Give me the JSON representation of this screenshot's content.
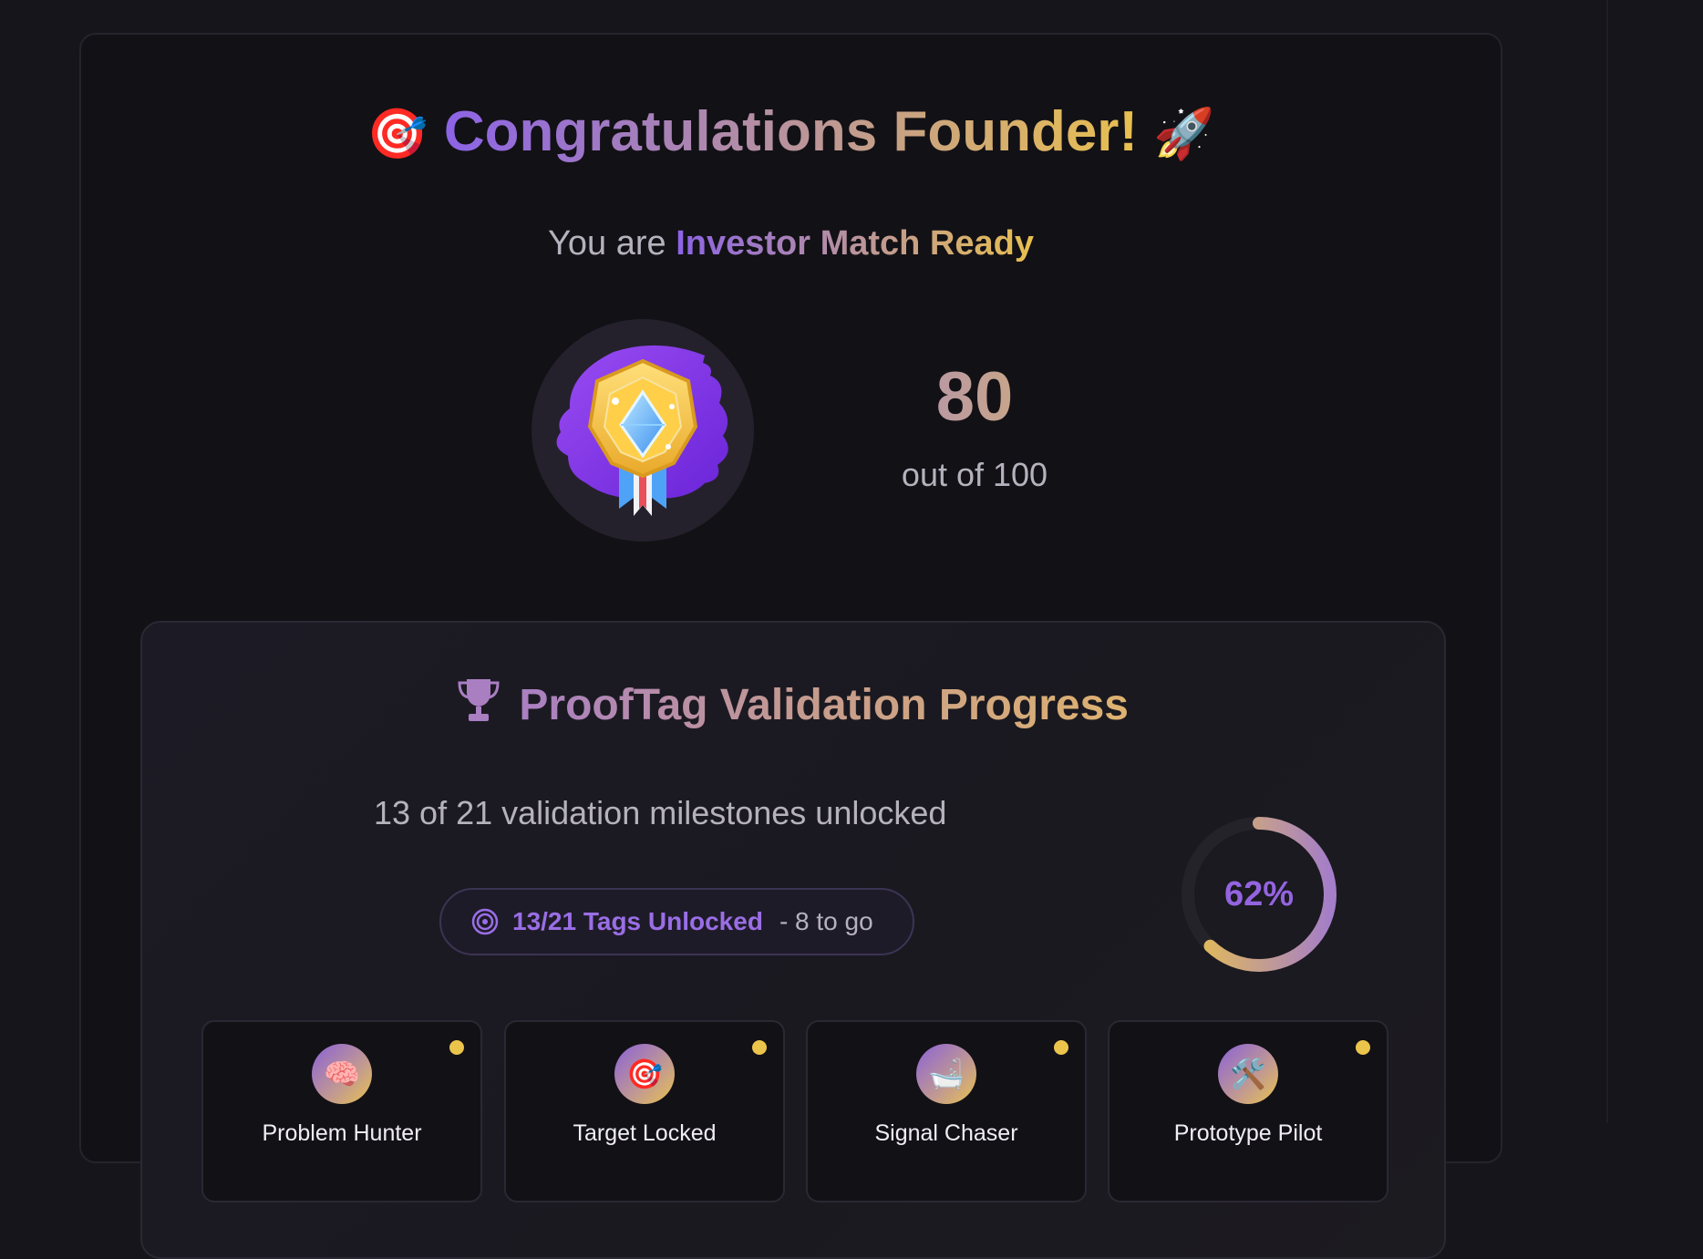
{
  "header": {
    "title_emoji_left": "🎯",
    "title": "Congratulations Founder!",
    "title_emoji_right": "🚀",
    "subtitle_prefix": "You are",
    "subtitle_highlight": "Investor Match Ready"
  },
  "score": {
    "value": "80",
    "caption": "out of 100"
  },
  "progress": {
    "title": "ProofTag Validation Progress",
    "milestones_text": "13 of 21 validation milestones unlocked",
    "pill_unlocked": "13/21 Tags Unlocked",
    "pill_remaining": "- 8 to go",
    "percent_label": "62%",
    "percent_value": 0.62
  },
  "tags": [
    {
      "emoji": "🧠",
      "label": "Problem Hunter",
      "icon": "brain-icon"
    },
    {
      "emoji": "🎯",
      "label": "Target Locked",
      "icon": "target-icon"
    },
    {
      "emoji": "🛁",
      "label": "Signal Chaser",
      "icon": "bathtub-icon"
    },
    {
      "emoji": "🛠️",
      "label": "Prototype Pilot",
      "icon": "tools-icon"
    }
  ],
  "colors": {
    "accent_purple": "#8c63e6",
    "accent_gold": "#e9c04f",
    "background": "#16151b"
  }
}
